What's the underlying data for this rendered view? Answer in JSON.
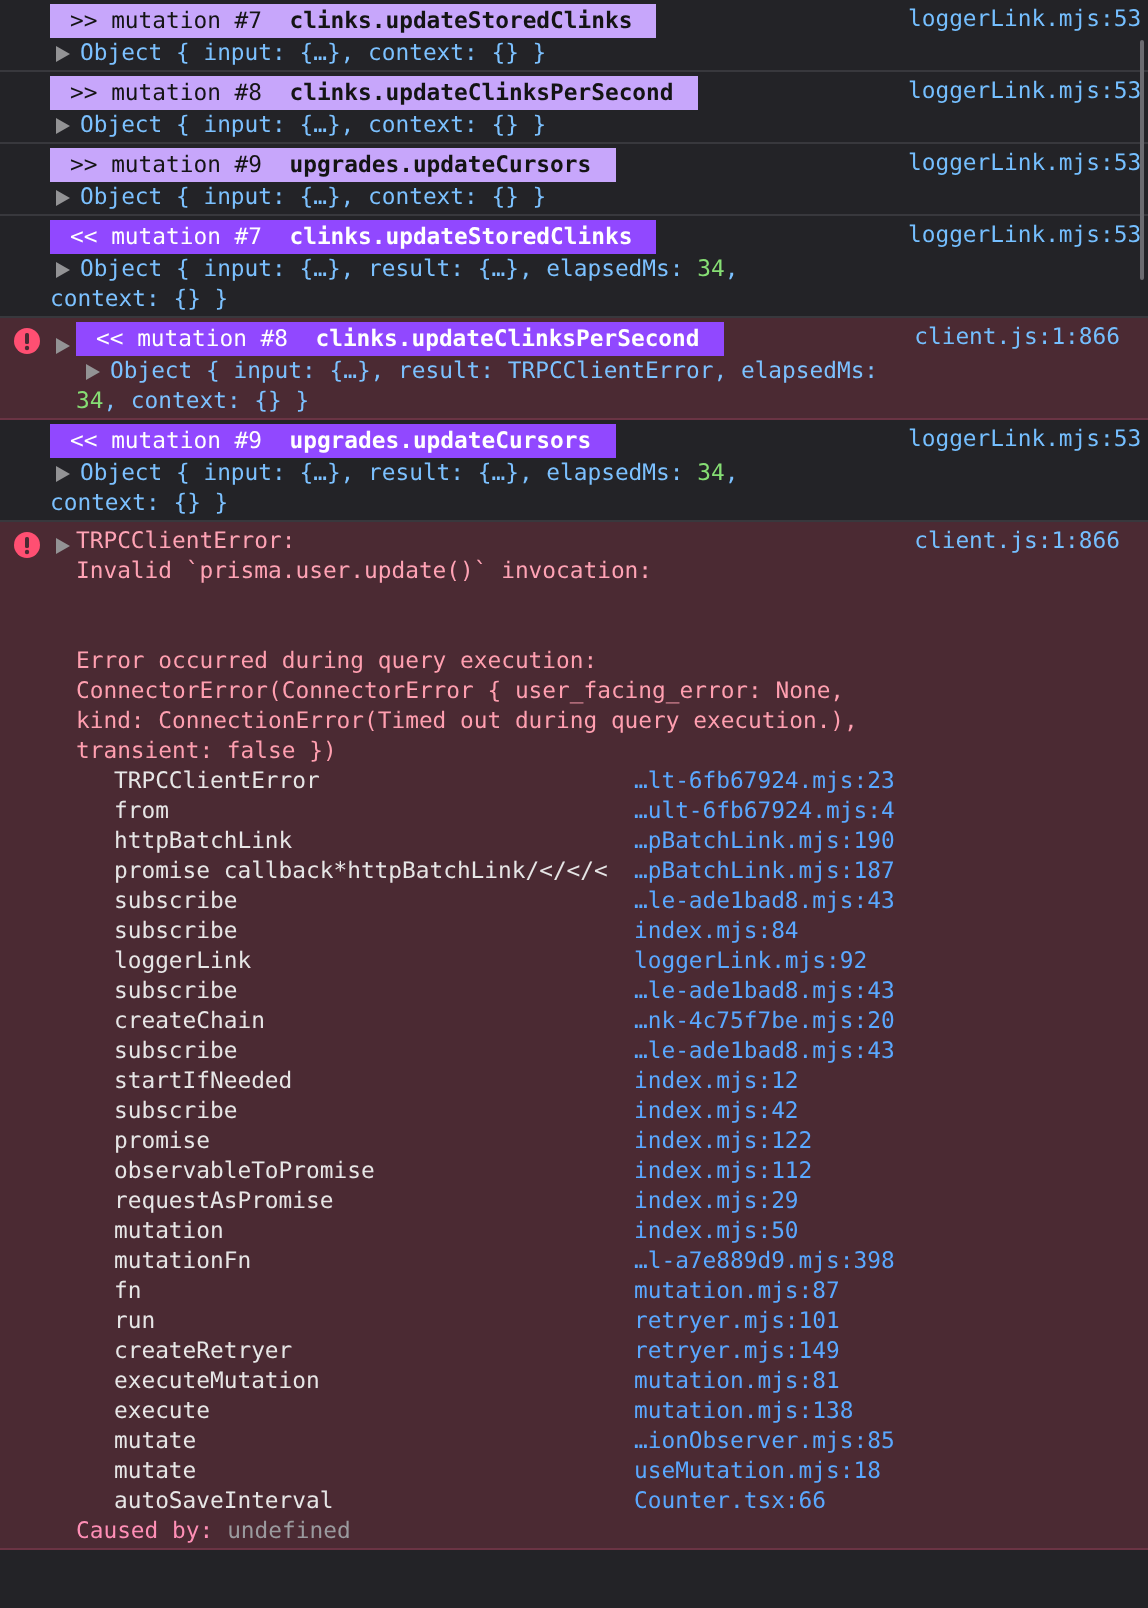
{
  "entries": [
    {
      "kind": "log",
      "badge": {
        "kind": "request",
        "arrow": ">>",
        "label": "mutation #7",
        "path": "clinks.updateStoredClinks"
      },
      "object_lines": [
        [
          {
            "text": "Object { input: {…}, context: {} }",
            "kind": "plain"
          }
        ]
      ],
      "location": "loggerLink.mjs:53"
    },
    {
      "kind": "log",
      "badge": {
        "kind": "request",
        "arrow": ">>",
        "label": "mutation #8",
        "path": "clinks.updateClinksPerSecond"
      },
      "object_lines": [
        [
          {
            "text": "Object { input: {…}, context: {} }",
            "kind": "plain"
          }
        ]
      ],
      "location": "loggerLink.mjs:53"
    },
    {
      "kind": "log",
      "badge": {
        "kind": "request",
        "arrow": ">>",
        "label": "mutation #9",
        "path": "upgrades.updateCursors"
      },
      "object_lines": [
        [
          {
            "text": "Object { input: {…}, context: {} }",
            "kind": "plain"
          }
        ]
      ],
      "location": "loggerLink.mjs:53"
    },
    {
      "kind": "log",
      "badge": {
        "kind": "response",
        "arrow": "<<",
        "label": "mutation #7",
        "path": "clinks.updateStoredClinks"
      },
      "object_lines": [
        [
          {
            "text": "Object { input: {…}, result: {…}, elapsedMs: ",
            "kind": "plain"
          },
          {
            "text": "34",
            "kind": "number"
          },
          {
            "text": ",",
            "kind": "plain"
          }
        ],
        [
          {
            "text": "context: {} }",
            "kind": "plain"
          }
        ]
      ],
      "location": "loggerLink.mjs:53"
    },
    {
      "kind": "error",
      "expanded": false,
      "badge": {
        "kind": "response",
        "arrow": "<<",
        "label": "mutation #8",
        "path": "clinks.updateClinksPerSecond"
      },
      "object_lines": [
        [
          {
            "text": "Object { input: {…}, result: TRPCClientError, elapsedMs:",
            "kind": "plain"
          }
        ],
        [
          {
            "text": "34",
            "kind": "number"
          },
          {
            "text": ", context: {} }",
            "kind": "plain"
          }
        ]
      ],
      "location": "client.js:1:866"
    },
    {
      "kind": "log",
      "badge": {
        "kind": "response",
        "arrow": "<<",
        "label": "mutation #9",
        "path": "upgrades.updateCursors"
      },
      "object_lines": [
        [
          {
            "text": "Object { input: {…}, result: {…}, elapsedMs: ",
            "kind": "plain"
          },
          {
            "text": "34",
            "kind": "number"
          },
          {
            "text": ",",
            "kind": "plain"
          }
        ],
        [
          {
            "text": "context: {} }",
            "kind": "plain"
          }
        ]
      ],
      "location": "loggerLink.mjs:53"
    },
    {
      "kind": "exception",
      "expanded": false,
      "message": [
        "TRPCClientError:",
        "Invalid `prisma.user.update()` invocation:"
      ],
      "details": [
        "Error occurred during query execution:",
        "ConnectorError(ConnectorError { user_facing_error: None,",
        "kind: ConnectionError(Timed out during query execution.),",
        "transient: false })"
      ],
      "stack": [
        {
          "function": "TRPCClientError",
          "location": "…lt-6fb67924.mjs:23"
        },
        {
          "function": "from",
          "location": "…ult-6fb67924.mjs:4"
        },
        {
          "function": "httpBatchLink",
          "location": "…pBatchLink.mjs:190"
        },
        {
          "function": "promise callback*httpBatchLink/</</<",
          "location": "…pBatchLink.mjs:187"
        },
        {
          "function": "subscribe",
          "location": "…le-ade1bad8.mjs:43"
        },
        {
          "function": "subscribe",
          "location": "index.mjs:84"
        },
        {
          "function": "loggerLink",
          "location": "loggerLink.mjs:92"
        },
        {
          "function": "subscribe",
          "location": "…le-ade1bad8.mjs:43"
        },
        {
          "function": "createChain",
          "location": "…nk-4c75f7be.mjs:20"
        },
        {
          "function": "subscribe",
          "location": "…le-ade1bad8.mjs:43"
        },
        {
          "function": "startIfNeeded",
          "location": "index.mjs:12"
        },
        {
          "function": "subscribe",
          "location": "index.mjs:42"
        },
        {
          "function": "promise",
          "location": "index.mjs:122"
        },
        {
          "function": "observableToPromise",
          "location": "index.mjs:112"
        },
        {
          "function": "requestAsPromise",
          "location": "index.mjs:29"
        },
        {
          "function": "mutation",
          "location": "index.mjs:50"
        },
        {
          "function": "mutationFn",
          "location": "…l-a7e889d9.mjs:398"
        },
        {
          "function": "fn",
          "location": "mutation.mjs:87"
        },
        {
          "function": "run",
          "location": "retryer.mjs:101"
        },
        {
          "function": "createRetryer",
          "location": "retryer.mjs:149"
        },
        {
          "function": "executeMutation",
          "location": "mutation.mjs:81"
        },
        {
          "function": "execute",
          "location": "mutation.mjs:138"
        },
        {
          "function": "mutate",
          "location": "…ionObserver.mjs:85"
        },
        {
          "function": "mutate",
          "location": "useMutation.mjs:18"
        },
        {
          "function": "autoSaveInterval",
          "location": "Counter.tsx:66"
        }
      ],
      "cause": {
        "label": "Caused by:",
        "value": "undefined"
      },
      "location": "client.js:1:866"
    }
  ]
}
